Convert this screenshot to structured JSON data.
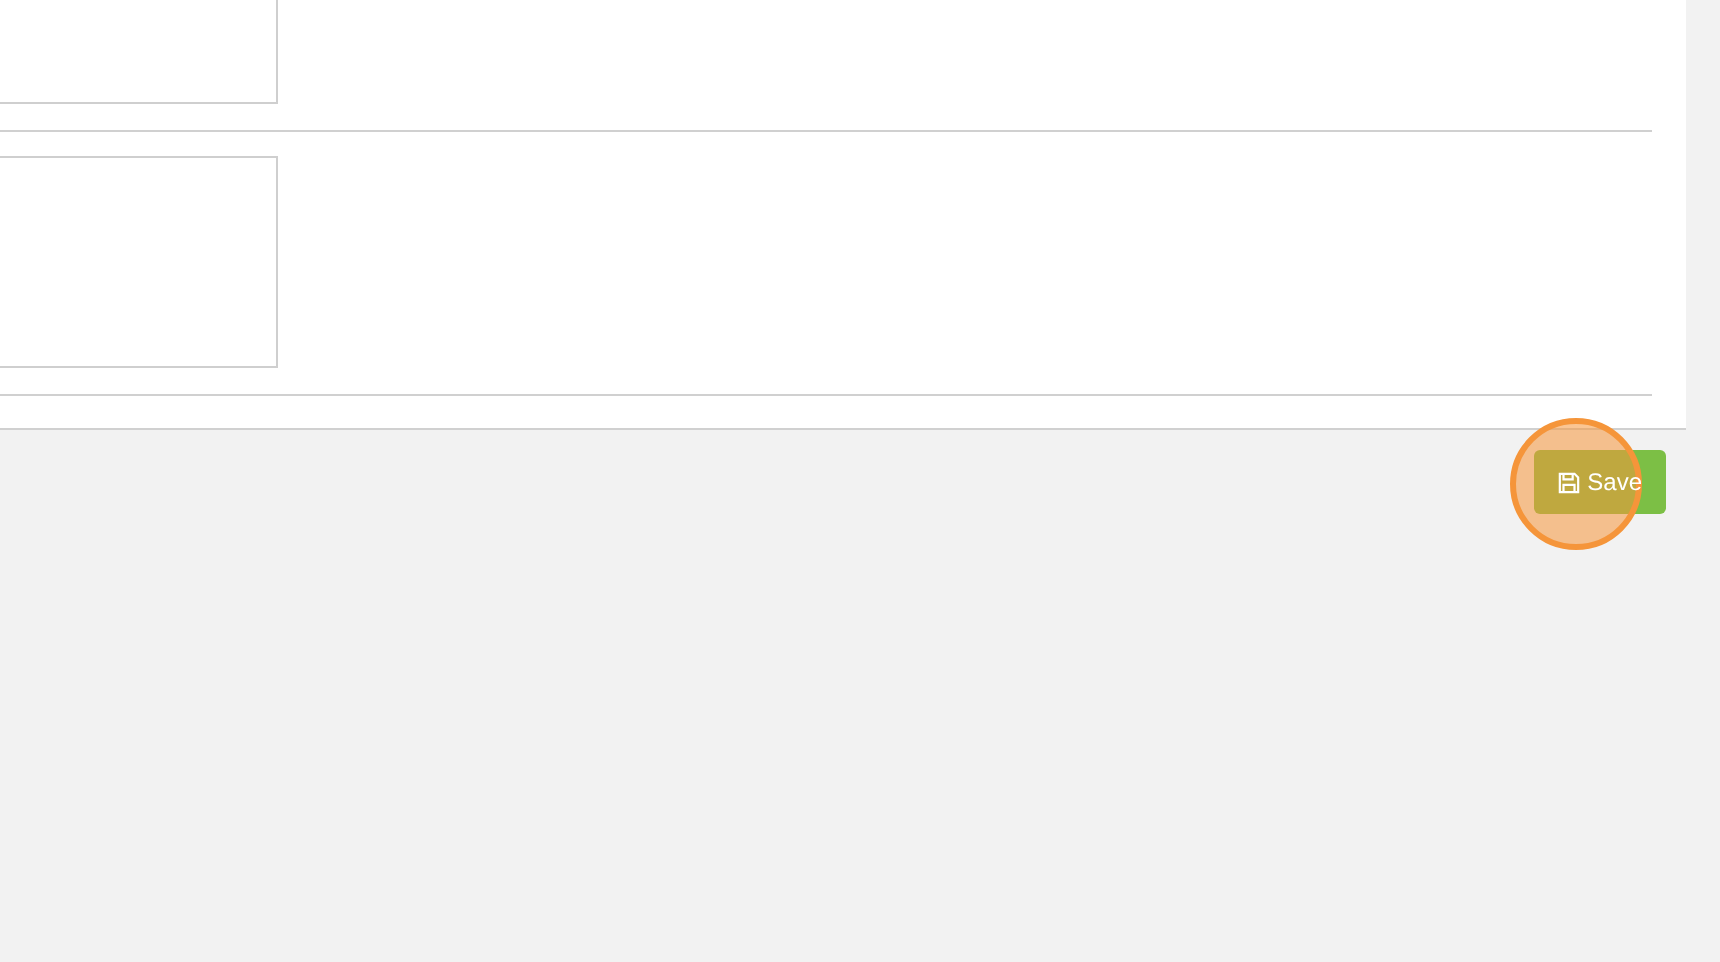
{
  "save_button": {
    "label": "Save",
    "highlighted": true
  }
}
